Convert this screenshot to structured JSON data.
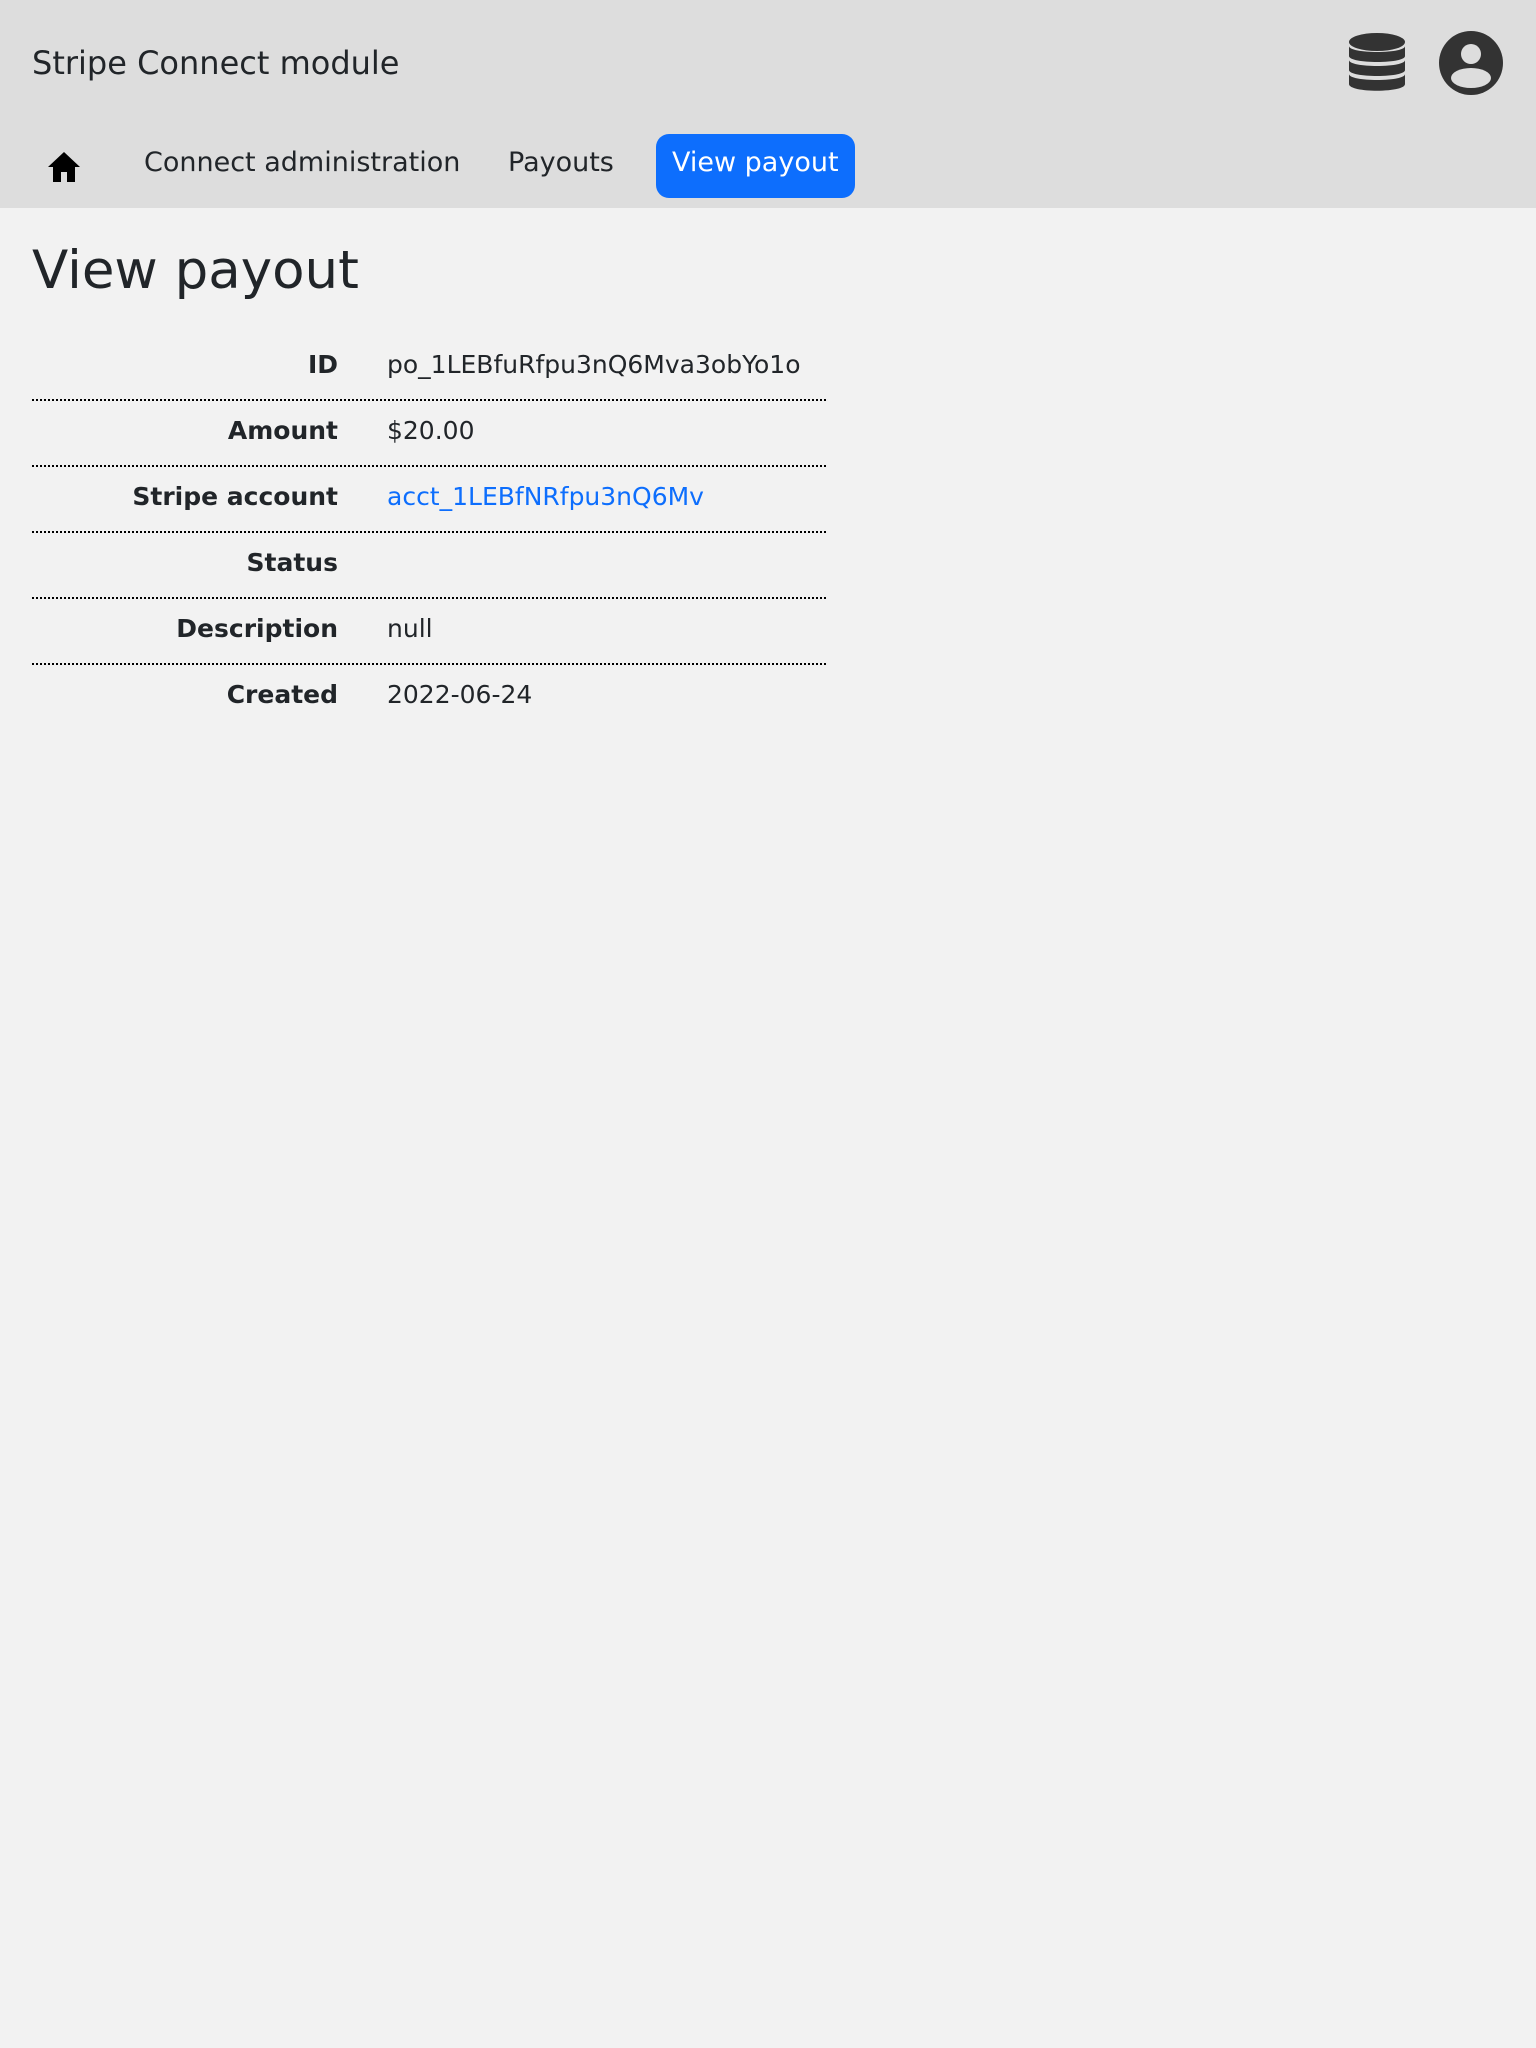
{
  "header": {
    "app_title": "Stripe Connect module",
    "icons": [
      "database-icon",
      "user-circle-icon"
    ]
  },
  "nav": {
    "home_icon": "home-icon",
    "items": [
      {
        "label": "Connect administration"
      },
      {
        "label": "Payouts"
      },
      {
        "label": "View payout",
        "active": true
      }
    ],
    "active_color": "#0d6efd"
  },
  "main": {
    "title": "View payout",
    "fields": [
      {
        "label": "ID",
        "value": "po_1LEBfuRfpu3nQ6Mva3obYo1o"
      },
      {
        "label": "Amount",
        "value": "$20.00"
      },
      {
        "label": "Stripe account",
        "value": "acct_1LEBfNRfpu3nQ6Mv",
        "link": true
      },
      {
        "label": "Status",
        "value": ""
      },
      {
        "label": "Description",
        "value": "null"
      },
      {
        "label": "Created",
        "value": "2022-06-24"
      }
    ],
    "link_color": "#0d6efd"
  }
}
